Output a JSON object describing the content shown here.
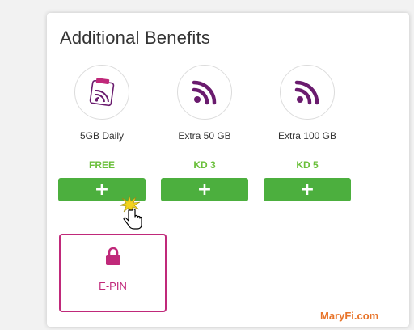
{
  "card": {
    "title": "Additional Benefits"
  },
  "benefits": [
    {
      "name": "5GB Daily",
      "price": "FREE",
      "icon": "daily-wifi-badge-icon",
      "add_label": "+"
    },
    {
      "name": "Extra 50 GB",
      "price": "KD 3",
      "icon": "rss-signal-icon",
      "add_label": "+"
    },
    {
      "name": "Extra 100 GB",
      "price": "KD 5",
      "icon": "rss-signal-icon",
      "add_label": "+"
    }
  ],
  "epin": {
    "label": "E-PIN",
    "icon": "lock-icon"
  },
  "colors": {
    "accent_purple": "#6a1b6e",
    "magenta": "#c0297a",
    "green_button": "#4caf3e",
    "price_green": "#6abf3a"
  },
  "watermark": "MaryFi.com"
}
